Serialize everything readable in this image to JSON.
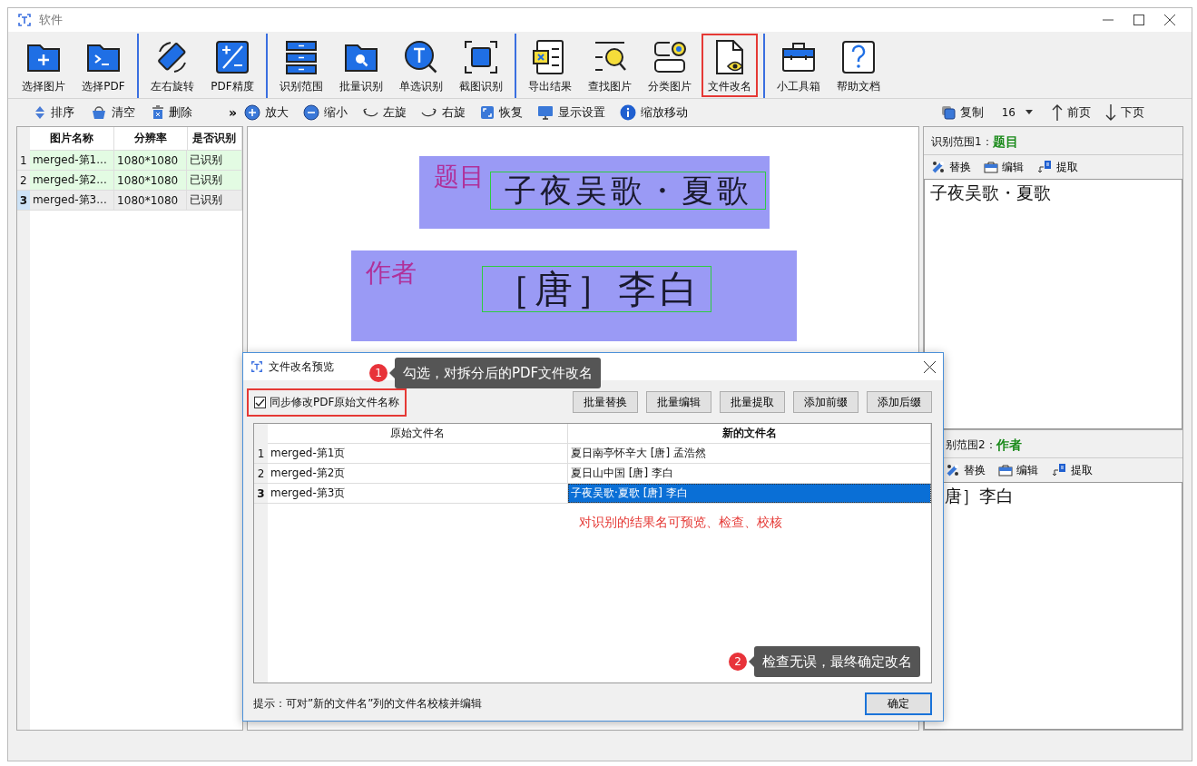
{
  "window": {
    "title": "软件"
  },
  "toolbar": {
    "groups": [
      [
        {
          "label": "选择图片",
          "highlighted": false
        },
        {
          "label": "选择PDF",
          "highlighted": false
        }
      ],
      [
        {
          "label": "左右旋转",
          "highlighted": false
        },
        {
          "label": "PDF精度",
          "highlighted": false
        }
      ],
      [
        {
          "label": "识别范围",
          "highlighted": false
        },
        {
          "label": "批量识别",
          "highlighted": false
        },
        {
          "label": "单选识别",
          "highlighted": false
        },
        {
          "label": "截图识别",
          "highlighted": false
        }
      ],
      [
        {
          "label": "导出结果",
          "highlighted": false
        },
        {
          "label": "查找图片",
          "highlighted": false
        },
        {
          "label": "分类图片",
          "highlighted": false
        },
        {
          "label": "文件改名",
          "highlighted": true
        }
      ],
      [
        {
          "label": "小工具箱",
          "highlighted": false
        },
        {
          "label": "帮助文档",
          "highlighted": false
        }
      ]
    ]
  },
  "sub_toolbar": {
    "list_tools": [
      "排序",
      "清空",
      "删除"
    ],
    "overflow": "»",
    "view_tools": [
      "放大",
      "缩小",
      "左旋",
      "右旋",
      "恢复",
      "显示设置",
      "缩放移动"
    ],
    "copy": "复制",
    "font_size": "16",
    "prev": "前页",
    "next": "下页"
  },
  "image_list": {
    "columns": [
      "图片名称",
      "分辨率",
      "是否识别"
    ],
    "rows": [
      {
        "index": "1",
        "name": "merged-第1...",
        "resolution": "1080*1080",
        "status": "已识别",
        "selected": false
      },
      {
        "index": "2",
        "name": "merged-第2...",
        "resolution": "1080*1080",
        "status": "已识别",
        "selected": false
      },
      {
        "index": "3",
        "name": "merged-第3...",
        "resolution": "1080*1080",
        "status": "已识别",
        "selected": true
      }
    ]
  },
  "canvas": {
    "regions": [
      {
        "label": "题目",
        "text": "子夜吴歌・夏歌"
      },
      {
        "label": "作者",
        "text": "［唐］李白"
      }
    ]
  },
  "results": [
    {
      "heading": "识别范围1：",
      "tag": "题目",
      "tools": [
        "替换",
        "编辑",
        "提取"
      ],
      "text": "子夜吴歌・夏歌"
    },
    {
      "heading": "别范围2：",
      "tag": "作者",
      "tools": [
        "替换",
        "编辑",
        "提取"
      ],
      "text": "唐］李白"
    }
  ],
  "dialog": {
    "title": "文件改名预览",
    "sync_checkbox": {
      "label": "同步修改PDF原始文件名称",
      "checked": true,
      "highlighted": true
    },
    "buttons": [
      "批量替换",
      "批量编辑",
      "批量提取",
      "添加前缀",
      "添加后缀"
    ],
    "columns": [
      "原始文件名",
      "新的文件名"
    ],
    "rows": [
      {
        "index": "1",
        "original": "merged-第1页",
        "new_name": "夏日南亭怀辛大  [唐] 孟浩然",
        "selected": false
      },
      {
        "index": "2",
        "original": "merged-第2页",
        "new_name": "夏日山中国  [唐]  李白",
        "selected": false
      },
      {
        "index": "3",
        "original": "merged-第3页",
        "new_name": "子夜吴歌·夏歌  [唐]  李白",
        "selected": true
      }
    ],
    "note": "对识别的结果名可预览、检查、校核",
    "hint": "提示：可对”新的文件名”列的文件名校核并编辑",
    "ok_button": "确定"
  },
  "callouts": [
    {
      "number": "1",
      "text": "勾选，对拆分后的PDF文件改名"
    },
    {
      "number": "2",
      "text": "检查无误，最终确定改名"
    }
  ]
}
